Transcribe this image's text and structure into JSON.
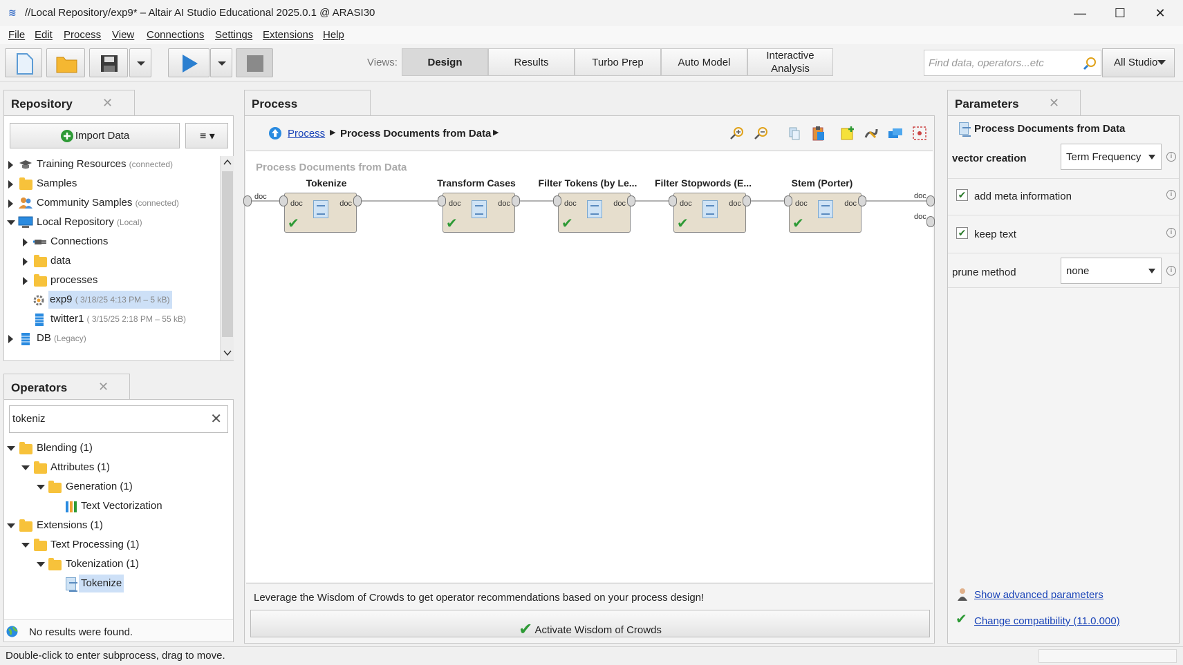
{
  "window": {
    "title": "//Local Repository/exp9* – Altair AI Studio Educational 2025.0.1 @ ARASI30",
    "minimize": "—",
    "maximize": "☐",
    "close": "✕"
  },
  "menu": [
    "File",
    "Edit",
    "Process",
    "View",
    "Connections",
    "Settings",
    "Extensions",
    "Help"
  ],
  "toolbar": {
    "views_label": "Views:",
    "views": [
      "Design",
      "Results",
      "Turbo Prep",
      "Auto Model",
      "Interactive Analysis"
    ],
    "active_view": "Design",
    "search_placeholder": "Find data, operators...etc",
    "scope": "All Studio"
  },
  "repository": {
    "title": "Repository",
    "import_button": "Import Data",
    "items": [
      {
        "label": "Training Resources",
        "sub": "(connected)"
      },
      {
        "label": "Samples",
        "sub": ""
      },
      {
        "label": "Community Samples",
        "sub": "(connected)"
      },
      {
        "label": "Local Repository",
        "sub": "(Local)"
      },
      {
        "label": "Connections",
        "sub": ""
      },
      {
        "label": "data",
        "sub": ""
      },
      {
        "label": "processes",
        "sub": ""
      },
      {
        "label": "exp9",
        "sub": "( 3/18/25 4:13 PM – 5 kB)"
      },
      {
        "label": "twitter1",
        "sub": "( 3/15/25 2:18 PM – 55 kB)"
      },
      {
        "label": "DB",
        "sub": "(Legacy)"
      }
    ]
  },
  "operators": {
    "title": "Operators",
    "search_value": "tokeniz",
    "items": [
      {
        "label": "Blending (1)"
      },
      {
        "label": "Attributes (1)"
      },
      {
        "label": "Generation (1)"
      },
      {
        "label": "Text Vectorization"
      },
      {
        "label": "Extensions (1)"
      },
      {
        "label": "Text Processing (1)"
      },
      {
        "label": "Tokenization (1)"
      },
      {
        "label": "Tokenize"
      }
    ],
    "status": "No results were found."
  },
  "process": {
    "title": "Process",
    "breadcrumb_root": "Process",
    "breadcrumb_current": "Process Documents from Data",
    "canvas_label": "Process Documents from Data",
    "port_label": "doc",
    "operators": [
      {
        "name": "Tokenize"
      },
      {
        "name": "Transform Cases"
      },
      {
        "name": "Filter Tokens (by Le..."
      },
      {
        "name": "Filter Stopwords (E..."
      },
      {
        "name": "Stem (Porter)"
      }
    ],
    "wisdom_text": "Leverage the Wisdom of Crowds to get operator recommendations based on your process design!",
    "wisdom_button": "Activate Wisdom of Crowds"
  },
  "parameters": {
    "title": "Parameters",
    "operator": "Process Documents from Data",
    "vector_creation_label": "vector creation",
    "vector_creation_value": "Term Frequency",
    "add_meta_label": "add meta information",
    "add_meta_checked": true,
    "keep_text_label": "keep text",
    "keep_text_checked": true,
    "prune_label": "prune method",
    "prune_value": "none",
    "advanced_link": "Show advanced parameters",
    "compat_link": "Change compatibility (11.0.000)"
  },
  "statusbar": {
    "text": "Double-click to enter subprocess, drag to move."
  },
  "colors": {
    "accent_blue": "#2b7fd0",
    "check_green": "#2e9a36",
    "operator_fill": "#e6decd",
    "link": "#1a44b8"
  }
}
